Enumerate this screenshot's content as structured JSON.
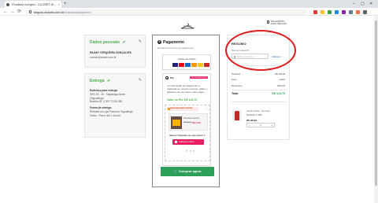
{
  "browser": {
    "tab_title": "Finalizar compra - CLOSET B...",
    "tab_close": "×",
    "new_tab": "+",
    "win_min": "–",
    "win_max": "▢",
    "win_close": "✕",
    "back": "←",
    "forward": "→",
    "reload": "⟳",
    "url_domain": "seguro.closetr.com.br",
    "url_path": "/checkout/payment",
    "ext_colors": [
      "#e53935",
      "#fbc02d",
      "#43a047",
      "#1e88e5",
      "#8e24aa",
      "#607d8b",
      "#ff7043",
      "#5f6368"
    ]
  },
  "header": {
    "logo_text": "CLOSET",
    "secure_line1": "PAGAMENTO",
    "secure_line2": "100% SEGURO"
  },
  "dados": {
    "title": "Dados pessoais",
    "check": "✔",
    "edit": "✎",
    "name": "RAIANY CERQUEIRA GONÇALVES",
    "email": "contato@closetr.com.br"
  },
  "entrega": {
    "title": "Entrega",
    "check": "✔",
    "edit": "✎",
    "addr_label": "Endereço para entrega:",
    "addr_line1": "SHG 26 - 28 - Taguatinga Norte",
    "addr_line2": "(Taguatinga)",
    "addr_line3": "Brasília-DF | CEP 72130-280",
    "forma_label": "Forma de entrega:",
    "forma_line1": "Retirada na Loja Física em Taguatinga",
    "forma_line2": "Grátis - Prazo: até 1 dia útil"
  },
  "pagamento": {
    "step": "3",
    "title": "Pagamento",
    "subtitle": "Escolha uma forma de pagamento",
    "card_title": "Cartão de crédito",
    "card_flag_colors": [
      "#1a237e",
      "#eb001b",
      "#1565c0",
      "#ff9800",
      "#fbc02d",
      "#c62828",
      "#6a1b9a"
    ],
    "pix_label": "Pix",
    "pix_badge": "5% DE DESCONTO",
    "pix_desc": "A confirmação do pagamento é realizada em poucos minutos. Utilize o aplicativo do seu banco para pagar.",
    "pix_valor": "Valor no Pix: R$ 124,70",
    "offer_head": "APROVEITE ESTA OFERTA",
    "offer_x": "×",
    "prod_name": "Chemise Gueri M",
    "prod_old": "R$ 99,90",
    "prod_new": "R$ 0,90",
    "offer_msg": "Nosso Chemise no seu carro!",
    "heart": "♥",
    "offer_btn": "Adicionar oferta",
    "dots": "● ● ●",
    "buy_btn": "Comprar agora"
  },
  "resumo": {
    "title": "RESUMO",
    "cupom_label": "Tem um cupom?",
    "cupom_placeholder": "Código do cupom",
    "cupom_btn": "Adicionar",
    "produtos_label": "Produtos",
    "produtos_val": "R$ 129,90",
    "frete_label": "Frete",
    "frete_val": "Grátis",
    "desconto_label": "Descontos",
    "desconto_val": "R$ 5,20",
    "total_label": "Total",
    "total_val": "R$ 124,70",
    "item_name": "Vestido Vitória - Vermelho",
    "item_size": "Tamanho: G (38)",
    "item_price": "R$ 129,90",
    "qty_minus": "–",
    "qty_val": "1",
    "qty_plus": "+"
  },
  "annotation": {
    "color": "#e01b1b"
  }
}
